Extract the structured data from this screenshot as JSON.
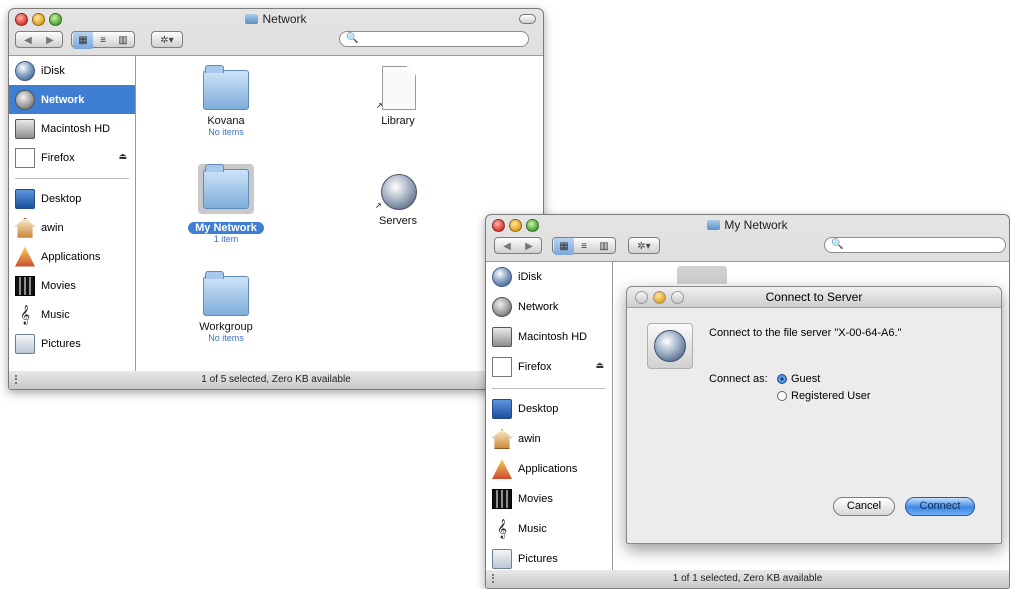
{
  "finder_back": {
    "title": "Network",
    "search_placeholder": "",
    "sidebar": [
      {
        "label": "iDisk",
        "icon": "idisk-icon"
      },
      {
        "label": "Network",
        "icon": "network-icon"
      },
      {
        "label": "Macintosh HD",
        "icon": "hard-drive-icon"
      },
      {
        "label": "Firefox",
        "icon": "disk-image-icon"
      },
      {
        "label": "Desktop",
        "icon": "desktop-icon"
      },
      {
        "label": "awin",
        "icon": "home-icon"
      },
      {
        "label": "Applications",
        "icon": "applications-icon"
      },
      {
        "label": "Movies",
        "icon": "movies-icon"
      },
      {
        "label": "Music",
        "icon": "music-icon"
      },
      {
        "label": "Pictures",
        "icon": "pictures-icon"
      }
    ],
    "selected_sidebar": "Network",
    "items": [
      {
        "name": "Kovana",
        "sub": "No items",
        "icon": "folder-icon"
      },
      {
        "name": "Library",
        "sub": "",
        "icon": "document-alias-icon"
      },
      {
        "name": "My Network",
        "sub": "1 item",
        "icon": "folder-icon"
      },
      {
        "name": "Servers",
        "sub": "",
        "icon": "server-alias-icon"
      },
      {
        "name": "Workgroup",
        "sub": "No items",
        "icon": "folder-icon"
      }
    ],
    "status": "1 of 5 selected, Zero KB available"
  },
  "finder_front": {
    "title": "My Network",
    "sidebar": [
      {
        "label": "iDisk"
      },
      {
        "label": "Network"
      },
      {
        "label": "Macintosh HD"
      },
      {
        "label": "Firefox"
      },
      {
        "label": "Desktop"
      },
      {
        "label": "awin"
      },
      {
        "label": "Applications"
      },
      {
        "label": "Movies"
      },
      {
        "label": "Music"
      },
      {
        "label": "Pictures"
      }
    ],
    "status": "1 of 1 selected, Zero KB available"
  },
  "dialog": {
    "title": "Connect to Server",
    "message": "Connect to the file server \"X-00-64-A6.\"",
    "connect_as_label": "Connect as:",
    "options": [
      "Guest",
      "Registered User"
    ],
    "selected_option": "Guest",
    "cancel_label": "Cancel",
    "connect_label": "Connect"
  },
  "eject_symbol": "⏏",
  "music_symbol": "𝄞",
  "toolbar_symbols": {
    "back": "◀",
    "forward": "▶",
    "icon_view": "▦",
    "list_view": "≡",
    "column_view": "▥",
    "action": "✲▾",
    "search": "🔍"
  },
  "colors": {
    "selection_blue": "#3e7fd4",
    "connect_button": "#3f88e3"
  }
}
